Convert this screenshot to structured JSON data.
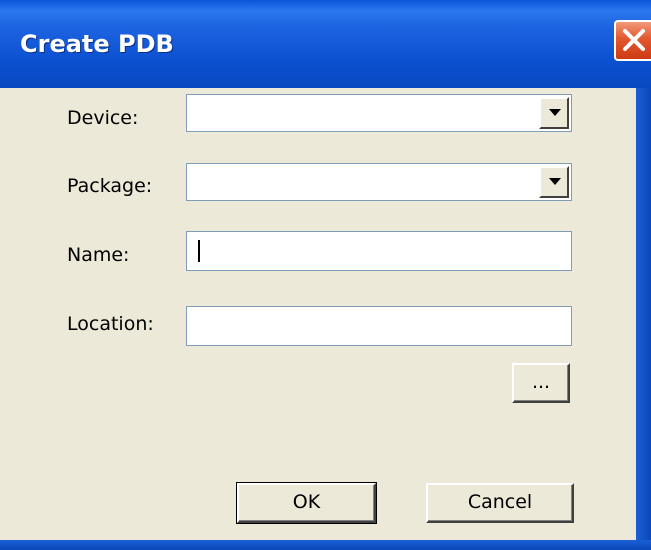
{
  "window": {
    "title": "Create PDB",
    "close_icon": "close-x-icon"
  },
  "form": {
    "device": {
      "label": "Device:",
      "value": "",
      "dropdown_icon": "chevron-down-icon"
    },
    "package": {
      "label": "Package:",
      "value": "",
      "dropdown_icon": "chevron-down-icon"
    },
    "name": {
      "label": "Name:",
      "value": ""
    },
    "location": {
      "label": "Location:",
      "value": ""
    },
    "browse_label": "..."
  },
  "buttons": {
    "ok_label": "OK",
    "cancel_label": "Cancel"
  },
  "colors": {
    "titlebar": "#0a54d8",
    "close_button": "#e2582f",
    "dialog_face": "#ece9d8",
    "field_border": "#7f9db9"
  }
}
